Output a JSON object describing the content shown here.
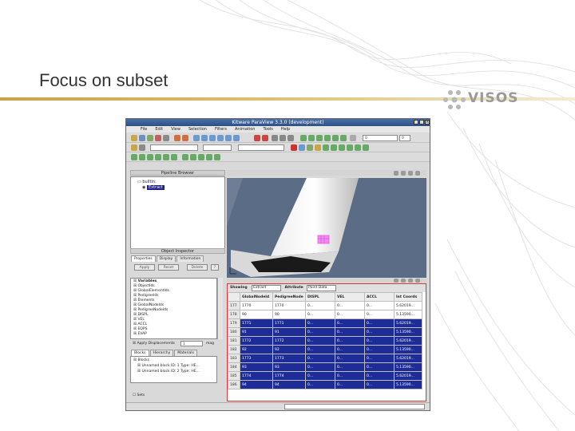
{
  "slide": {
    "title": "Focus on subset",
    "logo_text": "VISOS",
    "accent_color": "#c9a24a"
  },
  "app": {
    "window_title": "Kitware ParaView 3.3.0 (development)",
    "menus": [
      "File",
      "Edit",
      "View",
      "Selection",
      "Filters",
      "Animation",
      "Tools",
      "Help"
    ],
    "time_value": "0",
    "time_max": "0",
    "pipeline_header": "Pipeline Browser",
    "pipeline_items": [
      {
        "label": "builtin:",
        "selected": false
      },
      {
        "label": "Extract",
        "selected": true
      }
    ],
    "inspector_header": "Object Inspector",
    "inspector_tabs": [
      "Properties",
      "Display",
      "Information"
    ],
    "inspector_buttons": {
      "apply": "Apply",
      "reset": "Reset",
      "delete": "Delete",
      "help": "?"
    },
    "variables_header": "Variables",
    "variables": [
      "ObjectIds",
      "GlobalElementIds",
      "PedigreeIds",
      "Elements",
      "GlobalNodeIds",
      "PedigreeNodeIds",
      "DISPL",
      "VEL",
      "ACCL",
      "EQPS",
      "EVAP"
    ],
    "apply_displacement": "Apply Displacements",
    "apply_displacement_value": "1",
    "apply_displacement_unit": "mag",
    "block_tabs": [
      "Blocks",
      "Hierarchy",
      "Materials"
    ],
    "blocks": [
      "Unnamed block ID: 1 Type: HE...",
      "Unnamed block ID: 2 Type: HE..."
    ],
    "blocks_root": "Blocks",
    "sets_label": "Sets",
    "sheet": {
      "showing_label": "Showing",
      "source": "Extract",
      "attribute_label": "Attribute",
      "attribute_value": "Point Data",
      "columns": [
        "GlobalNodeId",
        "PedigreeNode",
        "DISPL",
        "VEL",
        "ACCL",
        "Int Coords"
      ],
      "rows": [
        {
          "n": "177",
          "cells": [
            "1770",
            "1770",
            "0...",
            "0...",
            "0...",
            "5.62019..."
          ],
          "selected": false
        },
        {
          "n": "178",
          "cells": [
            "90",
            "90",
            "0...",
            "0...",
            "0...",
            "5.13590..."
          ],
          "selected": false
        },
        {
          "n": "179",
          "cells": [
            "1771",
            "1771",
            "0...",
            "0...",
            "0...",
            "5.62019..."
          ],
          "selected": true
        },
        {
          "n": "180",
          "cells": [
            "91",
            "91",
            "0...",
            "0...",
            "0...",
            "5.13590..."
          ],
          "selected": true
        },
        {
          "n": "181",
          "cells": [
            "1772",
            "1772",
            "0...",
            "0...",
            "0...",
            "5.62019..."
          ],
          "selected": true
        },
        {
          "n": "182",
          "cells": [
            "92",
            "92",
            "0...",
            "0...",
            "0...",
            "5.13590..."
          ],
          "selected": true
        },
        {
          "n": "183",
          "cells": [
            "1773",
            "1773",
            "0...",
            "0...",
            "0...",
            "5.62019..."
          ],
          "selected": true
        },
        {
          "n": "184",
          "cells": [
            "93",
            "93",
            "0...",
            "0...",
            "0...",
            "5.13590..."
          ],
          "selected": true
        },
        {
          "n": "185",
          "cells": [
            "1774",
            "1774",
            "0...",
            "0...",
            "0...",
            "5.62019..."
          ],
          "selected": true
        },
        {
          "n": "186",
          "cells": [
            "94",
            "94",
            "0...",
            "0...",
            "0...",
            "5.13590..."
          ],
          "selected": true
        }
      ]
    }
  }
}
